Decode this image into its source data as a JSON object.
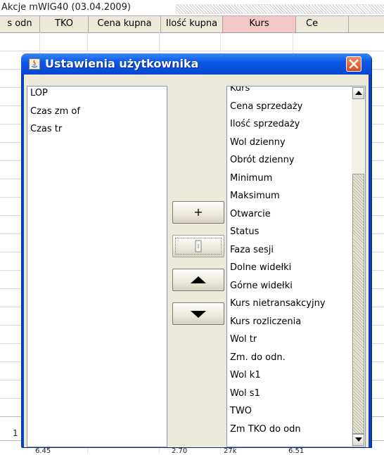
{
  "background": {
    "window_title": "Akcje mWIG40 (03.04.2009)",
    "columns": [
      {
        "label": "s odn",
        "selected": false
      },
      {
        "label": "TKO",
        "selected": false
      },
      {
        "label": "Cena kupna",
        "selected": false
      },
      {
        "label": "Ilość kupna",
        "selected": false
      },
      {
        "label": "Kurs",
        "selected": true
      },
      {
        "label": "Ce",
        "selected": false
      }
    ],
    "row_fragment": "1",
    "bottom_values": [
      "6.45",
      "2.70",
      "27k",
      "6.51"
    ]
  },
  "dialog": {
    "title": "Ustawienia użytkownika",
    "title_icon": "java-icon",
    "close_icon": "close-icon",
    "left_list": [
      "LOP",
      "Czas zm of",
      "Czas tr"
    ],
    "buttons": {
      "add_label": "+",
      "remove_icon": "remove-icon",
      "move_up_icon": "arrow-up-icon",
      "move_down_icon": "arrow-down-icon"
    },
    "right_list": [
      "Kurs",
      "Cena sprzedaży",
      "Ilość sprzedaży",
      "Wol dzienny",
      "Obrót dzienny",
      "Minimum",
      "Maksimum",
      "Otwarcie",
      "Status",
      "Faza sesji",
      "Dolne widełki",
      "Górne widełki",
      "Kurs nietransakcyjny",
      "Kurs rozliczenia",
      "Wol tr",
      "Zm. do odn.",
      "Wol k1",
      "Wol s1",
      "TWO",
      "Zm TKO do odn"
    ]
  },
  "colors": {
    "titlebar": "#0c58e6",
    "close_button": "#d9481d",
    "selected_column": "#f6c7c7",
    "dialog_body": "#ece9d8"
  }
}
